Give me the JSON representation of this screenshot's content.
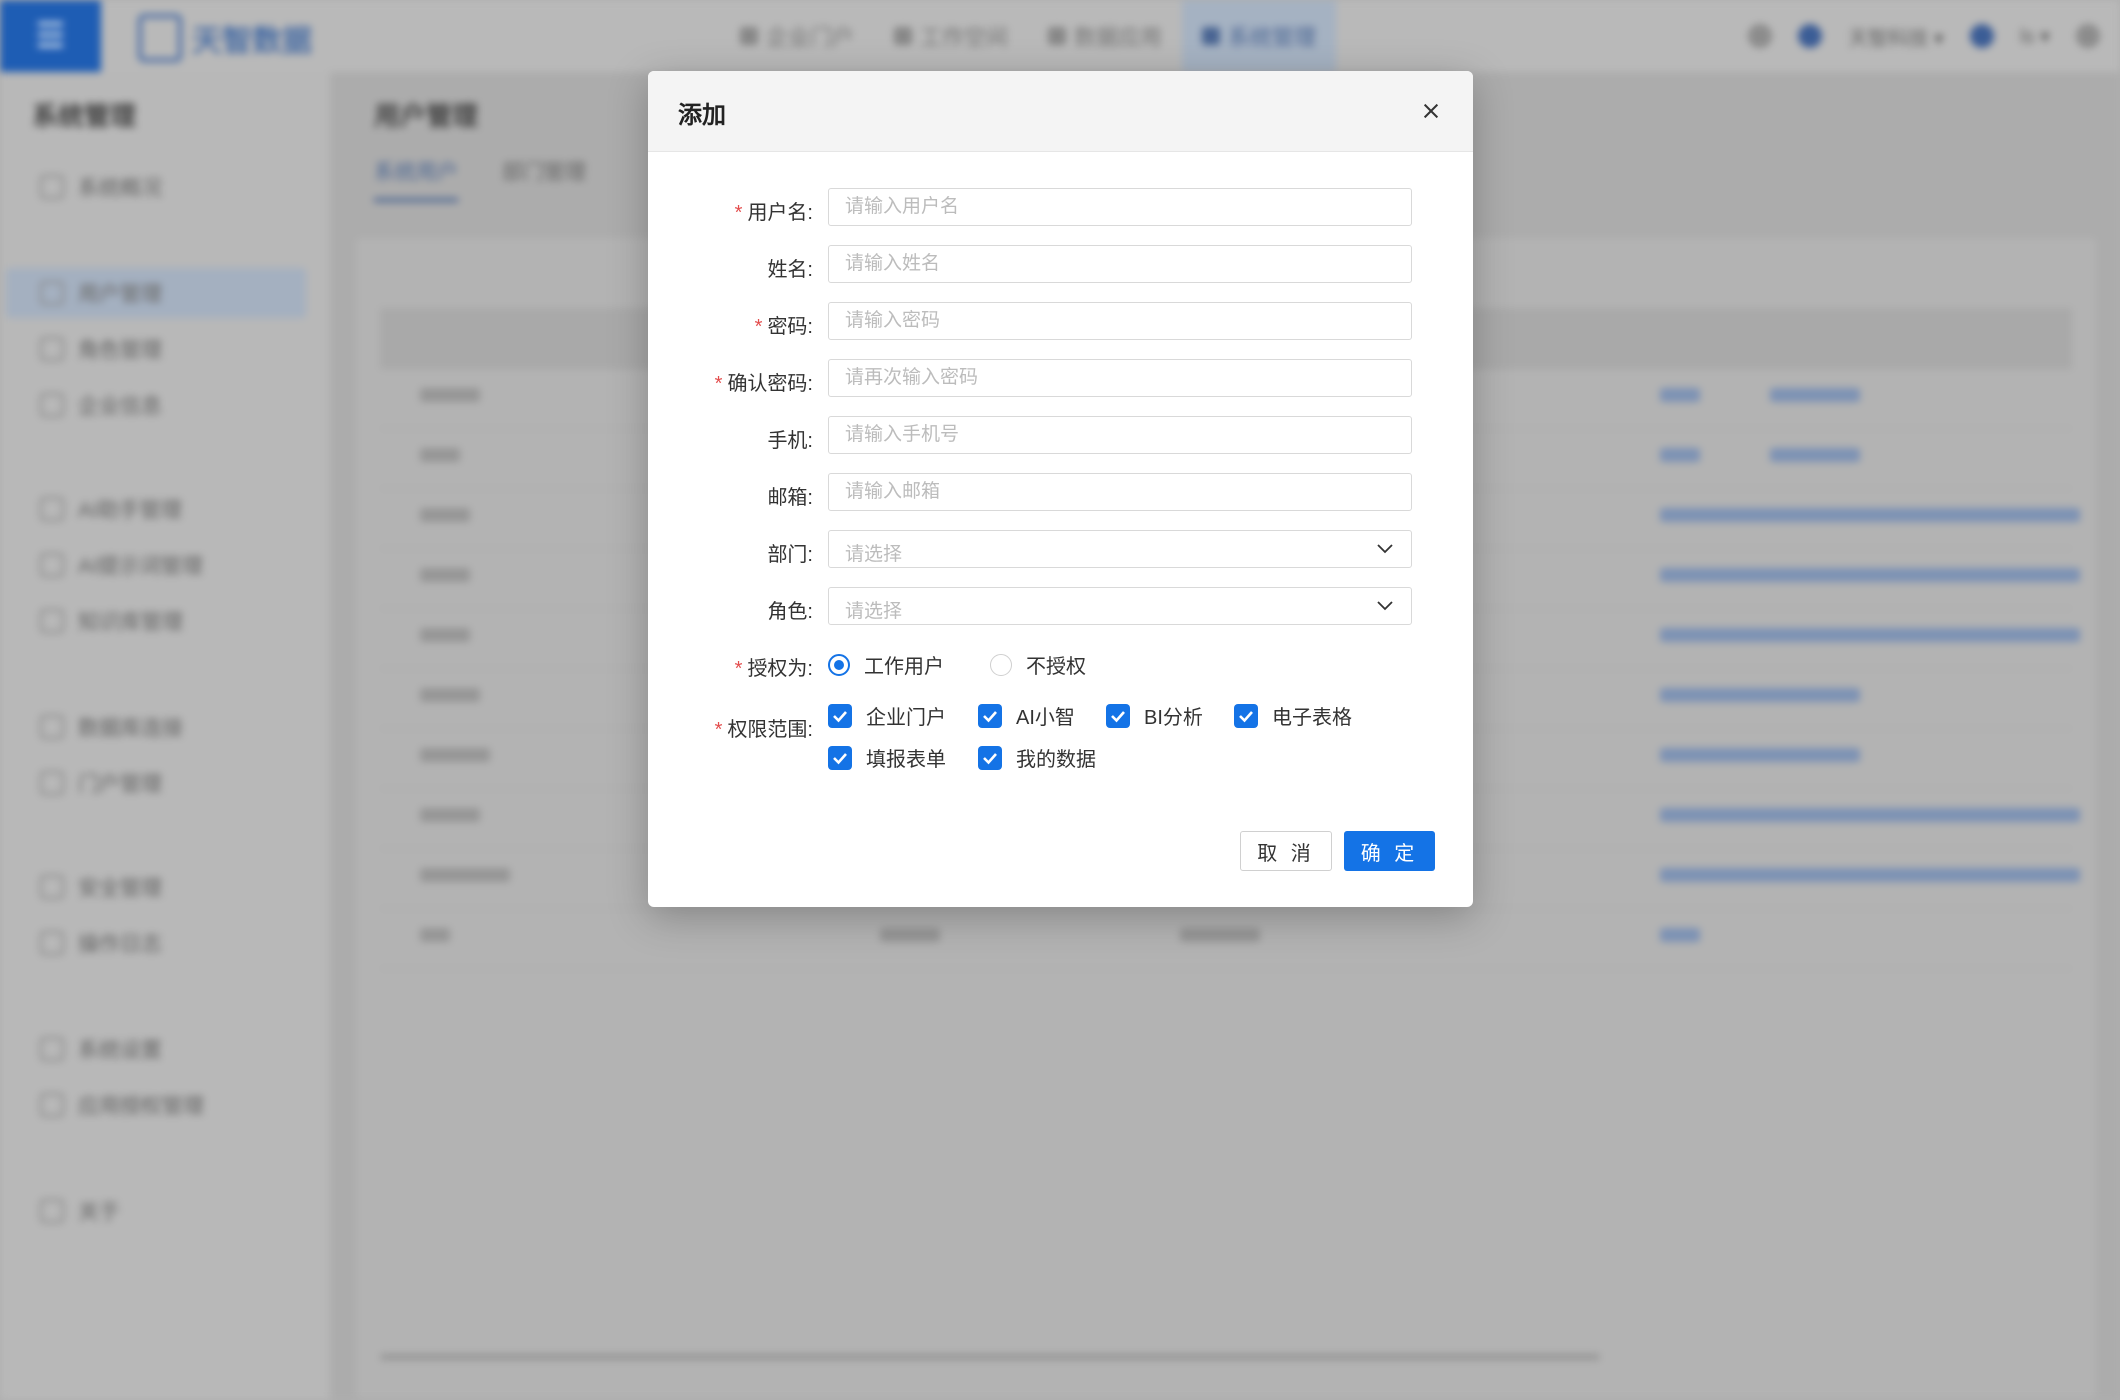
{
  "app": {
    "logo_text": "天智数据"
  },
  "topnav": {
    "items": [
      {
        "label": "企业门户"
      },
      {
        "label": "工作空间"
      },
      {
        "label": "数据应用"
      },
      {
        "label": "系统管理"
      }
    ],
    "user_label": "ls ▾",
    "tenant_label": "天智科技 ▾"
  },
  "sidebar": {
    "title": "系统管理",
    "items": [
      {
        "label": "系统概况"
      },
      {
        "label": "用户管理"
      },
      {
        "label": "角色管理"
      },
      {
        "label": "企业信息"
      },
      {
        "label": "AI助手管理"
      },
      {
        "label": "AI提示词管理"
      },
      {
        "label": "知识库管理"
      },
      {
        "label": "数据库连接"
      },
      {
        "label": "门户管理"
      },
      {
        "label": "安全管理"
      },
      {
        "label": "操作日志"
      },
      {
        "label": "系统设置"
      },
      {
        "label": "应用授权管理"
      },
      {
        "label": "关于"
      }
    ]
  },
  "main": {
    "title": "用户管理",
    "tabs": [
      {
        "label": "系统用户"
      },
      {
        "label": "部门管理"
      }
    ]
  },
  "dialog": {
    "title": "添加",
    "fields": {
      "username": {
        "label": "用户名:",
        "placeholder": "请输入用户名",
        "required": true
      },
      "fullname": {
        "label": "姓名:",
        "placeholder": "请输入姓名",
        "required": false
      },
      "password": {
        "label": "密码:",
        "placeholder": "请输入密码",
        "required": true
      },
      "confirm_password": {
        "label": "确认密码:",
        "placeholder": "请再次输入密码",
        "required": true
      },
      "phone": {
        "label": "手机:",
        "placeholder": "请输入手机号",
        "required": false
      },
      "email": {
        "label": "邮箱:",
        "placeholder": "请输入邮箱",
        "required": false
      },
      "department": {
        "label": "部门:",
        "placeholder": "请选择",
        "required": false
      },
      "role": {
        "label": "角色:",
        "placeholder": "请选择",
        "required": false
      }
    },
    "authorize": {
      "label": "授权为:",
      "options": [
        {
          "label": "工作用户",
          "selected": true
        },
        {
          "label": "不授权",
          "selected": false
        }
      ]
    },
    "scope": {
      "label": "权限范围:",
      "options": [
        {
          "label": "企业门户",
          "checked": true
        },
        {
          "label": "AI小智",
          "checked": true
        },
        {
          "label": "BI分析",
          "checked": true
        },
        {
          "label": "电子表格",
          "checked": true
        },
        {
          "label": "填报表单",
          "checked": true
        },
        {
          "label": "我的数据",
          "checked": true
        }
      ]
    },
    "buttons": {
      "cancel": "取 消",
      "ok": "确 定"
    },
    "required_mark": "*"
  },
  "colors": {
    "primary": "#1473e6",
    "required": "#e34d4d"
  }
}
